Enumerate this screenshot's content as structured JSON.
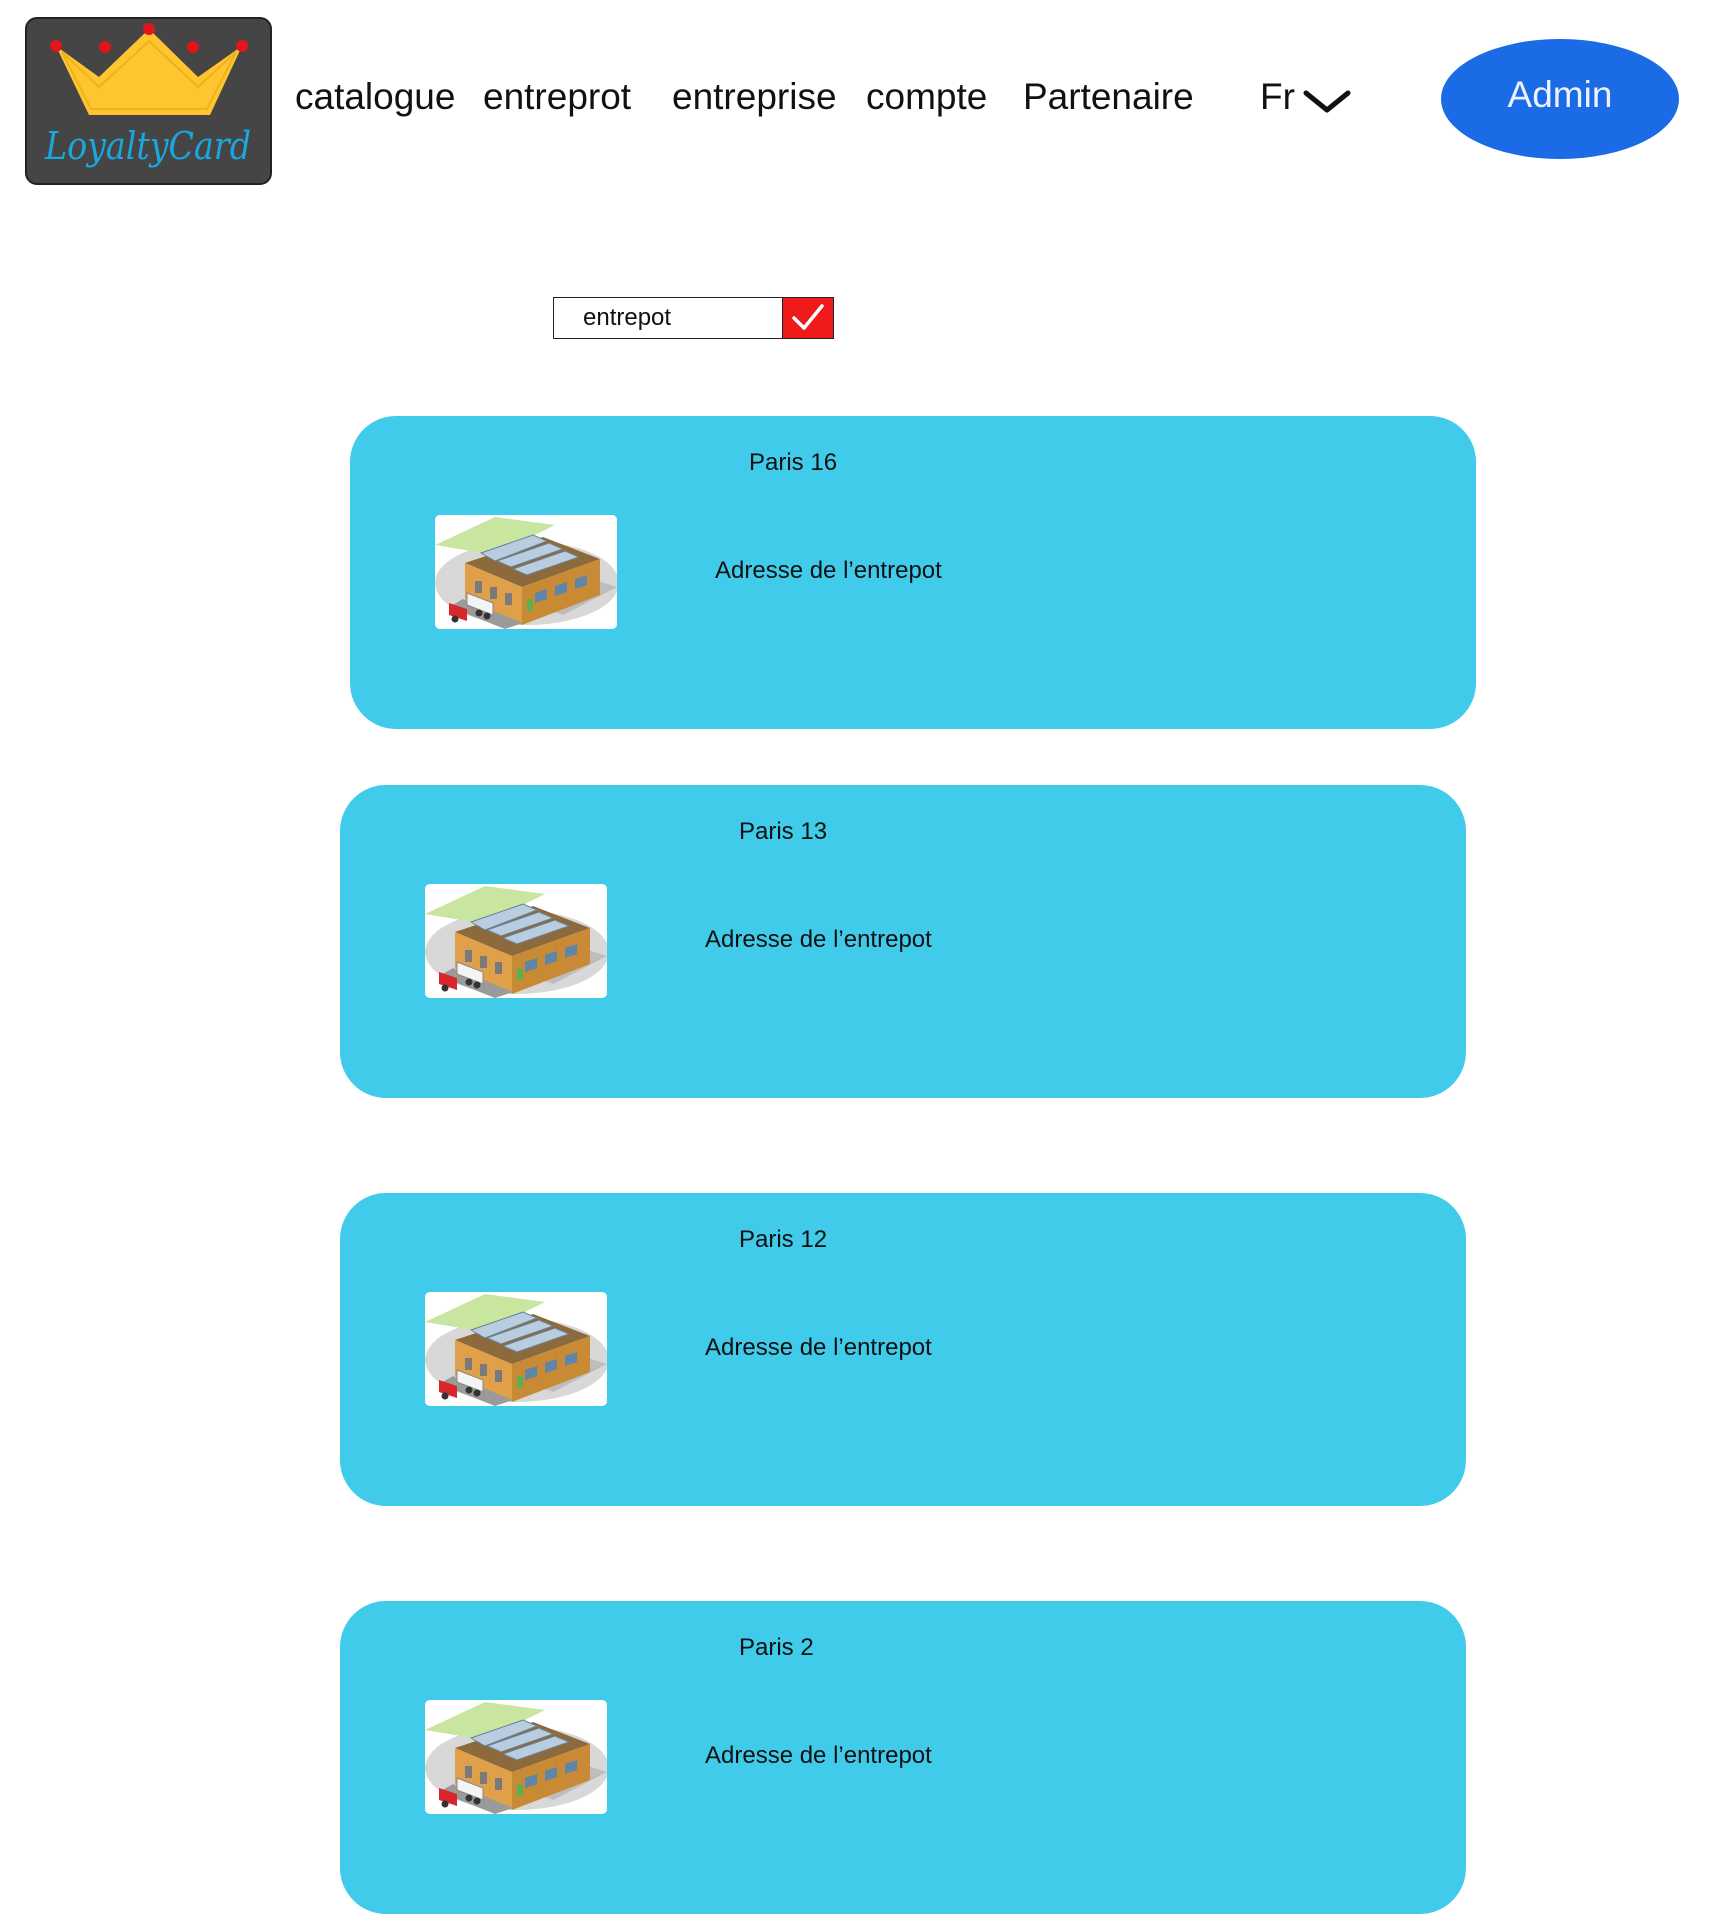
{
  "brand": {
    "logo_text": "LoyaltyCard"
  },
  "nav": {
    "items": [
      "catalogue",
      "entreprot",
      "entreprise",
      "compte",
      "Partenaire"
    ]
  },
  "language": {
    "selected": "Fr"
  },
  "admin_button": {
    "label": "Admin"
  },
  "search": {
    "value": "entrepot"
  },
  "warehouses": [
    {
      "title": "Paris 16",
      "address": "Adresse de l’entrepot"
    },
    {
      "title": "Paris 13",
      "address": "Adresse de l’entrepot"
    },
    {
      "title": "Paris 12",
      "address": "Adresse de l’entrepot"
    },
    {
      "title": "Paris 2",
      "address": "Adresse de l’entrepot"
    }
  ],
  "colors": {
    "card_background": "#41cbea",
    "admin_button": "#1b6ae6",
    "submit_button": "#f01a1a",
    "logo_background": "#454545",
    "crown": "#ffc530",
    "logo_text": "#1aa7e0"
  }
}
